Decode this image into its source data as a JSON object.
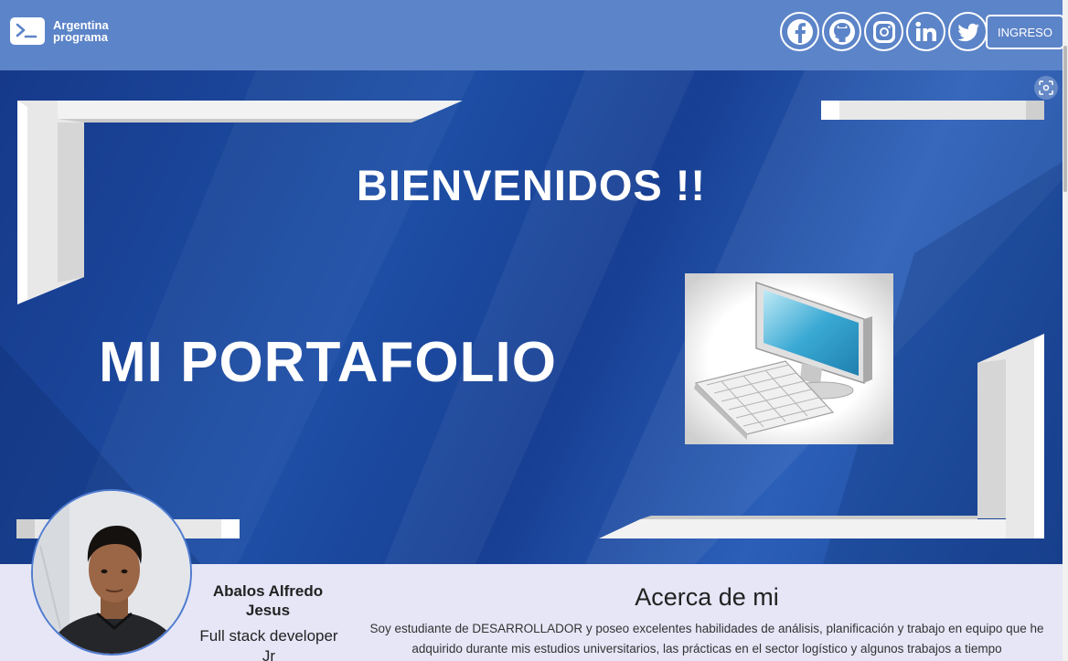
{
  "header": {
    "logo_line1": "Argentina",
    "logo_line2": "programa",
    "login_label": "INGRESO",
    "socials": [
      "facebook-icon",
      "github-icon",
      "instagram-icon",
      "linkedin-icon",
      "twitter-icon"
    ]
  },
  "banner": {
    "welcome": "BIENVENIDOS !!",
    "title": "MI PORTAFOLIO"
  },
  "profile": {
    "name": "Abalos Alfredo Jesus",
    "role": "Full stack developer Jr"
  },
  "about": {
    "title": "Acerca de mi",
    "text": "Soy estudiante de DESARROLLADOR y poseo excelentes habilidades de análisis, planificación y trabajo en equipo que he adquirido durante mis estudios universitarios, las prácticas en el sector logístico y algunos trabajos a tiempo"
  },
  "colors": {
    "header_bg": "#5c84c8",
    "banner_bg": "#1e4fa6",
    "section_bg": "#e6e6f7"
  }
}
